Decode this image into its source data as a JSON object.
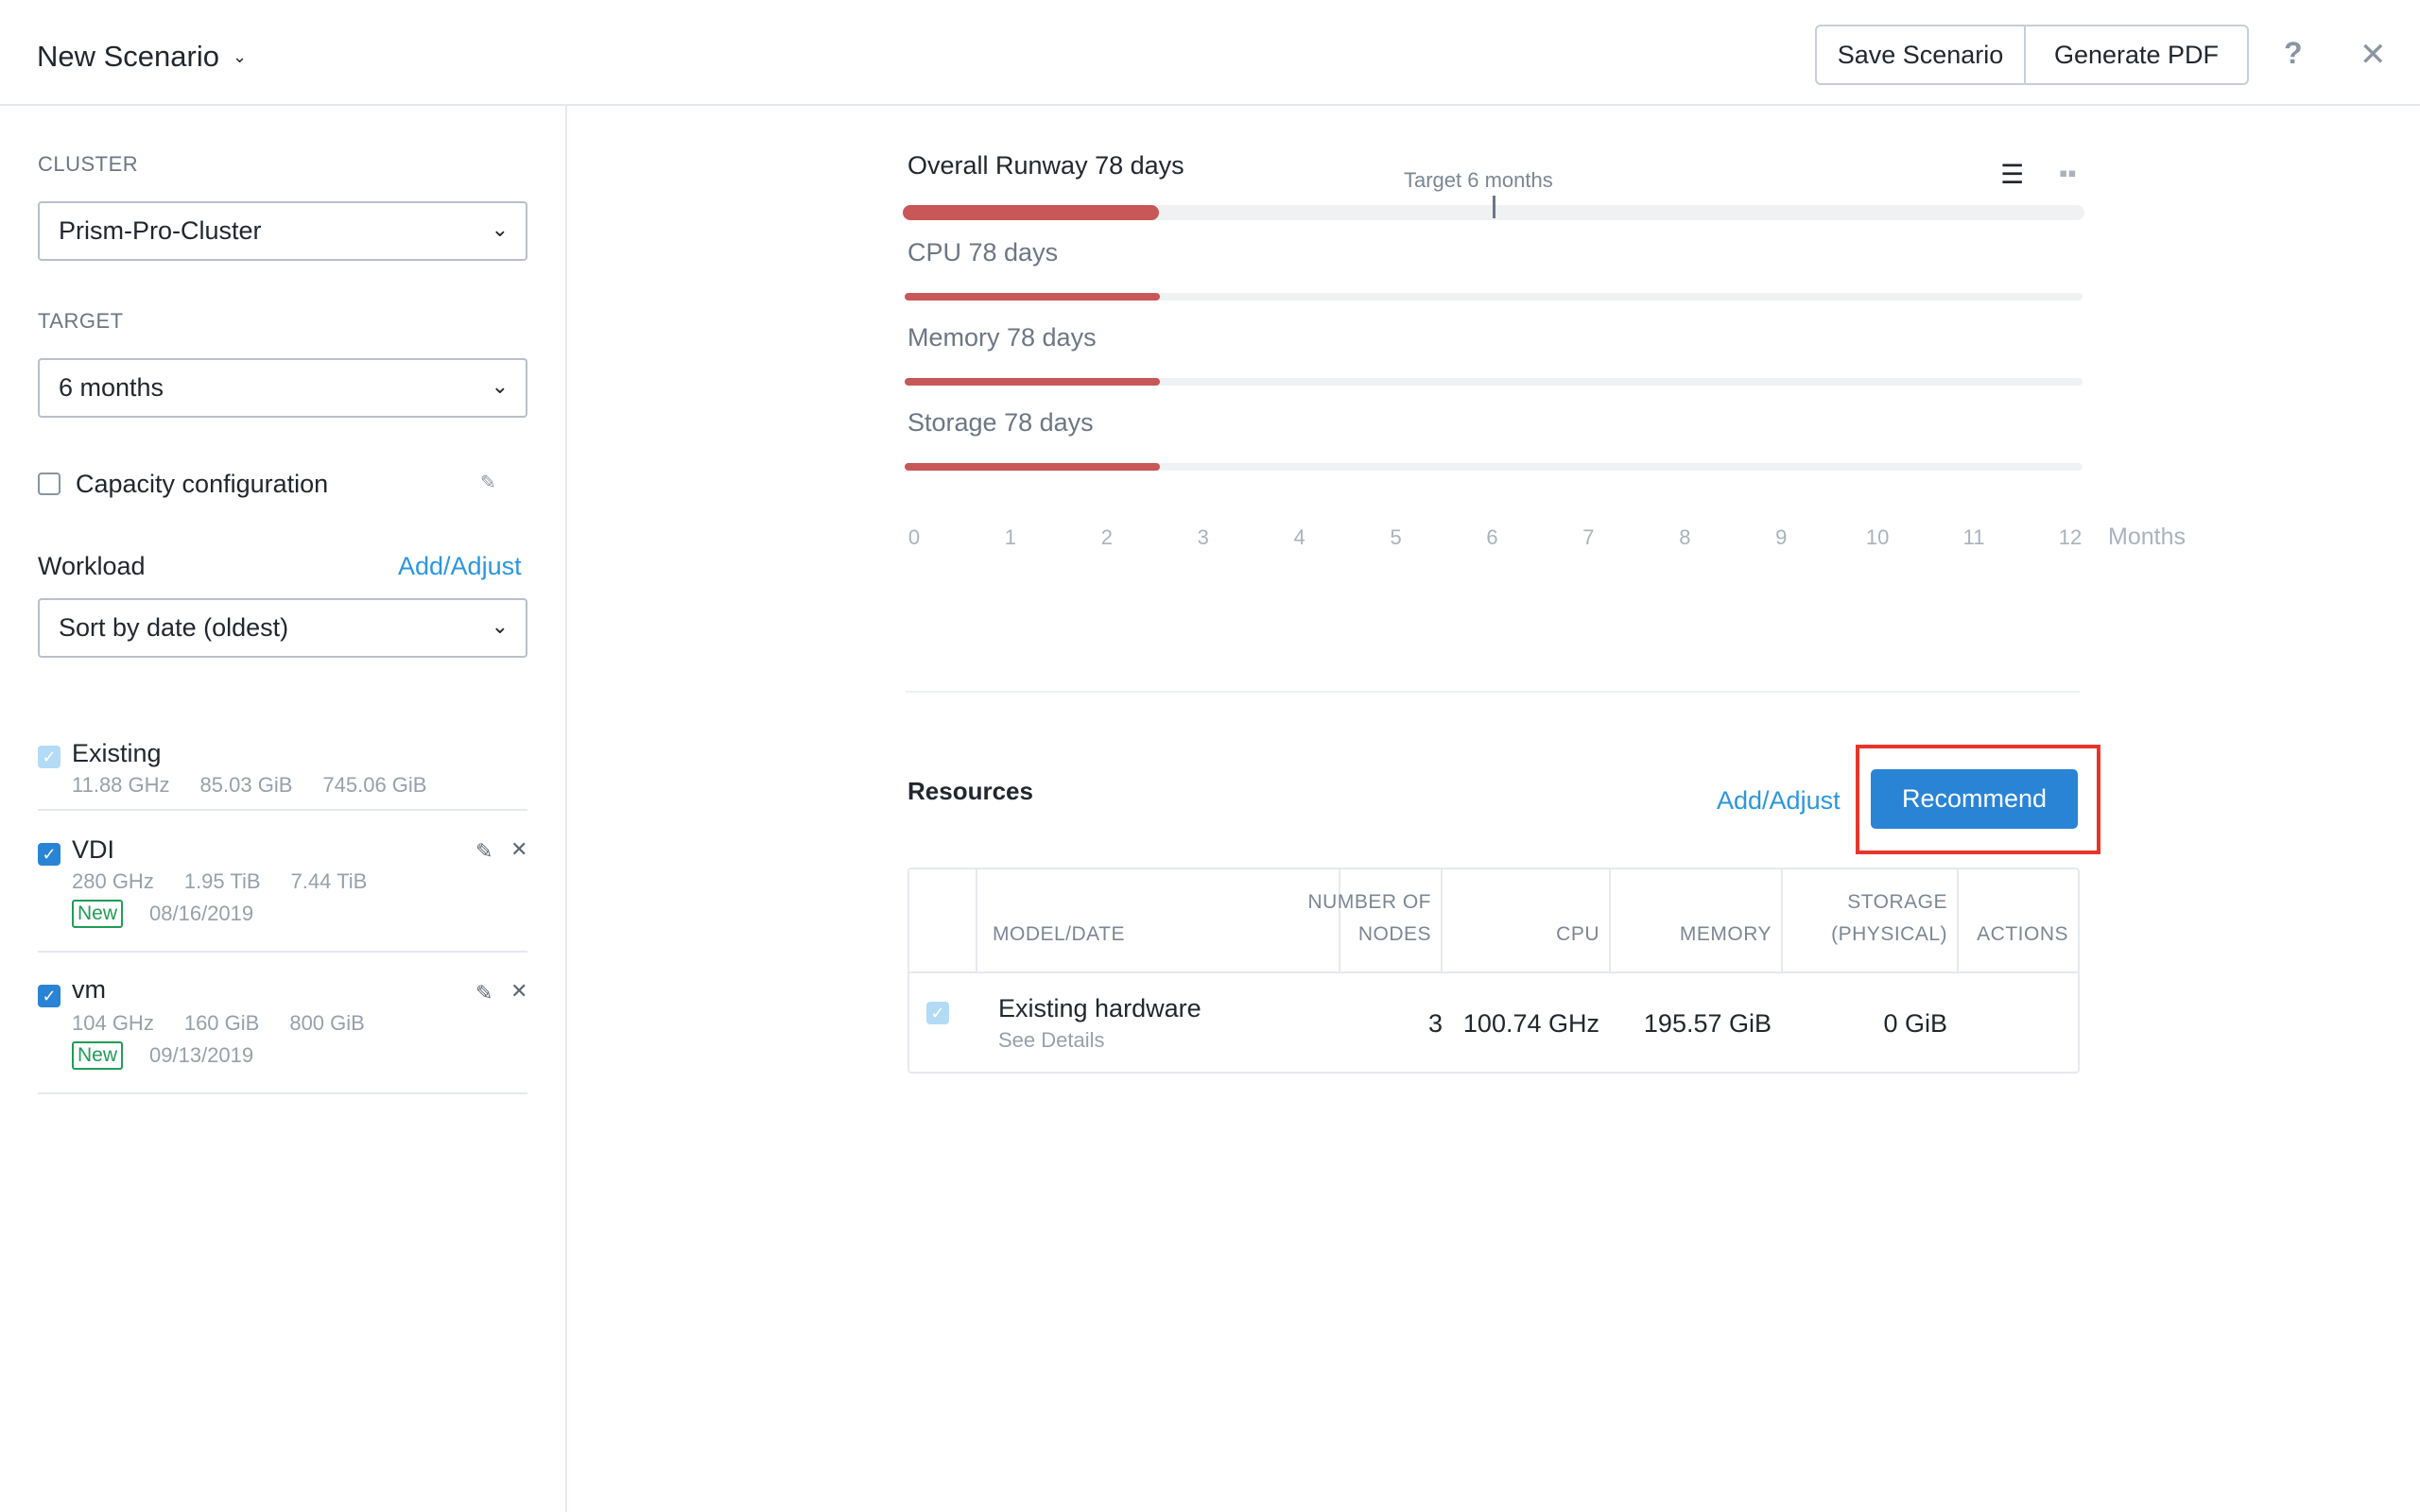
{
  "header": {
    "title": "New Scenario",
    "save_label": "Save Scenario",
    "pdf_label": "Generate PDF",
    "help_glyph": "?",
    "close_glyph": "✕"
  },
  "sidebar": {
    "cluster_label": "CLUSTER",
    "cluster_value": "Prism-Pro-Cluster",
    "target_label": "TARGET",
    "target_value": "6 months",
    "capacity_label": "Capacity configuration",
    "workload_label": "Workload",
    "workload_add": "Add/Adjust",
    "sort_value": "Sort by date (oldest)",
    "workloads": [
      {
        "name": "Existing",
        "cpu": "11.88 GHz",
        "memory": "85.03 GiB",
        "storage": "745.06 GiB"
      },
      {
        "name": "VDI",
        "cpu": "280 GHz",
        "memory": "1.95 TiB",
        "storage": "7.44 TiB",
        "badge": "New",
        "date": "08/16/2019"
      },
      {
        "name": "vm",
        "cpu": "104 GHz",
        "memory": "160 GiB",
        "storage": "800 GiB",
        "badge": "New",
        "date": "09/13/2019"
      }
    ]
  },
  "runway": {
    "overall": "Overall Runway 78 days",
    "target_text": "Target 6 months",
    "cpu": "CPU 78 days",
    "memory": "Memory 78 days",
    "storage": "Storage 78 days",
    "ticks": [
      "0",
      "1",
      "2",
      "3",
      "4",
      "5",
      "6",
      "7",
      "8",
      "9",
      "10",
      "11",
      "12"
    ],
    "unit": "Months",
    "runway_months": 2.6,
    "target_months": 6,
    "max_months": 12,
    "bar_color": "#c85758"
  },
  "resources": {
    "title": "Resources",
    "add_label": "Add/Adjust",
    "recommend_label": "Recommend",
    "columns": {
      "model": "MODEL/DATE",
      "nodes_1": "NUMBER OF",
      "nodes_2": "NODES",
      "cpu": "CPU",
      "memory": "MEMORY",
      "storage_1": "STORAGE",
      "storage_2": "(PHYSICAL)",
      "actions": "ACTIONS"
    },
    "row": {
      "model": "Existing hardware",
      "details": "See Details",
      "nodes": "3",
      "cpu": "100.74 GHz",
      "memory": "195.57 GiB",
      "storage": "0 GiB"
    }
  }
}
